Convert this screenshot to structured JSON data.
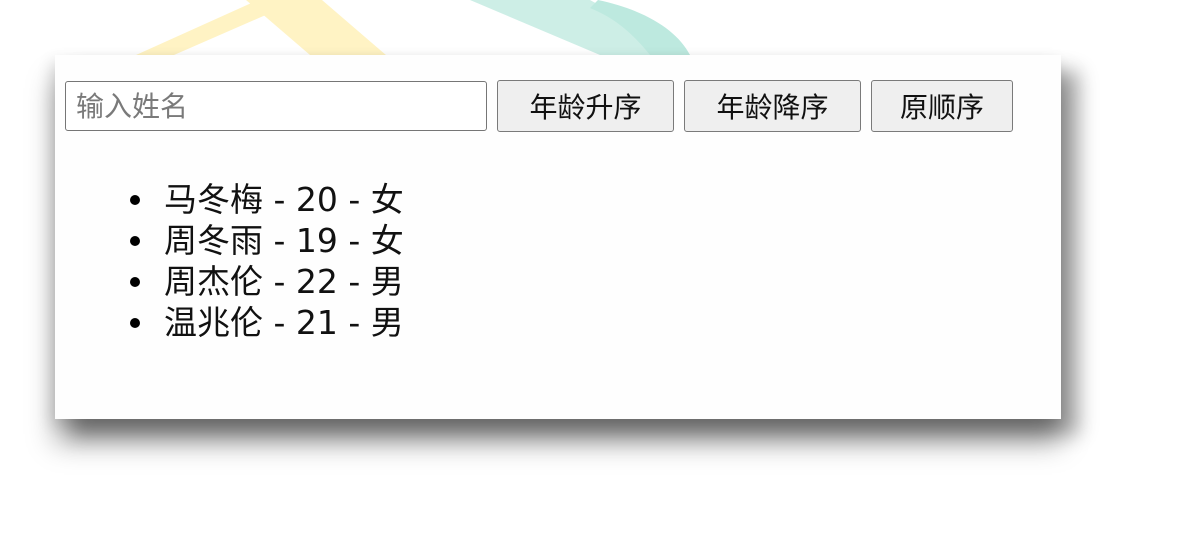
{
  "search": {
    "placeholder": "输入姓名",
    "value": ""
  },
  "buttons": {
    "age_ascending": "年龄升序",
    "age_descending": "年龄降序",
    "original_order": "原顺序"
  },
  "people": [
    {
      "label": "马冬梅 - 20 - 女"
    },
    {
      "label": "周冬雨 - 19 - 女"
    },
    {
      "label": "周杰伦 - 22 - 男"
    },
    {
      "label": "温兆伦 - 21 - 男"
    }
  ],
  "colors": {
    "decor_yellow": "#fff3c4",
    "decor_teal": "#cdeee6",
    "button_background": "#efefef",
    "button_border": "#7a7a7a",
    "text": "#111111"
  }
}
